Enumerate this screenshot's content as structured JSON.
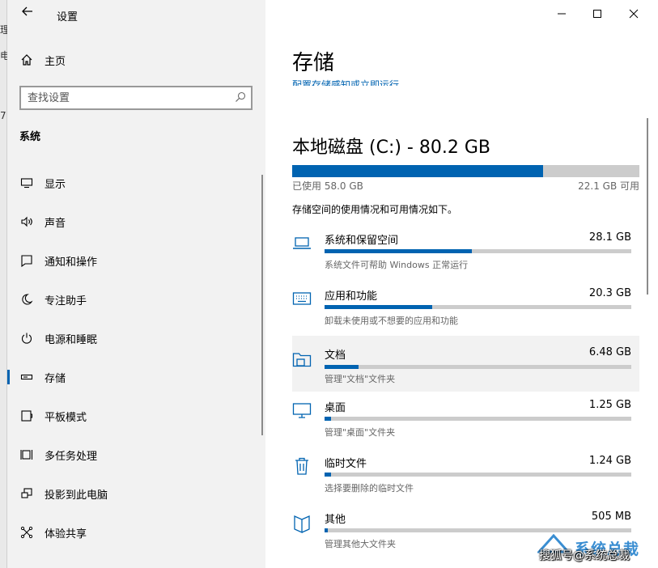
{
  "background_fragments": [
    "理",
    "电",
    "7"
  ],
  "window": {
    "title": "设置"
  },
  "sidebar": {
    "home_label": "主页",
    "search_placeholder": "查找设置",
    "section_title": "系统",
    "items": [
      {
        "label": "显示",
        "icon": "monitor-icon"
      },
      {
        "label": "声音",
        "icon": "speaker-icon"
      },
      {
        "label": "通知和操作",
        "icon": "notification-icon"
      },
      {
        "label": "专注助手",
        "icon": "moon-icon"
      },
      {
        "label": "电源和睡眠",
        "icon": "power-icon"
      },
      {
        "label": "存储",
        "icon": "storage-icon",
        "selected": true
      },
      {
        "label": "平板模式",
        "icon": "tablet-icon"
      },
      {
        "label": "多任务处理",
        "icon": "multitask-icon"
      },
      {
        "label": "投影到此电脑",
        "icon": "project-icon"
      },
      {
        "label": "体验共享",
        "icon": "share-icon"
      }
    ]
  },
  "main": {
    "title": "存储",
    "subtitle_link": "配置存储感知或立即运行",
    "drive": {
      "title": "本地磁盘 (C:) - 80.2 GB",
      "used": "已使用 58.0 GB",
      "free": "22.1 GB 可用",
      "used_fraction": 0.723
    },
    "description": "存储空间的使用情况和可用情况如下。",
    "categories": [
      {
        "name": "系统和保留空间",
        "size": "28.1 GB",
        "sub": "系统文件可帮助 Windows 正常运行",
        "fraction": 0.48,
        "icon": "laptop-icon"
      },
      {
        "name": "应用和功能",
        "size": "20.3 GB",
        "sub": "卸载未使用或不想要的应用和功能",
        "fraction": 0.35,
        "icon": "keyboard-icon"
      },
      {
        "name": "文档",
        "size": "6.48 GB",
        "sub": "管理\"文档\"文件夹",
        "fraction": 0.11,
        "icon": "folder-icon",
        "highlighted": true
      },
      {
        "name": "桌面",
        "size": "1.25 GB",
        "sub": "管理\"桌面\"文件夹",
        "fraction": 0.02,
        "icon": "desktop-icon"
      },
      {
        "name": "临时文件",
        "size": "1.24 GB",
        "sub": "选择要删除的临时文件",
        "fraction": 0.02,
        "icon": "trash-icon"
      },
      {
        "name": "其他",
        "size": "505 MB",
        "sub": "管理其他大文件夹",
        "fraction": 0.01,
        "icon": "book-icon"
      }
    ]
  },
  "watermark": {
    "brand": "系统总裁",
    "text": "搜狐号@系统总裁"
  },
  "colors": {
    "accent": "#0063b1",
    "bar_bg": "#cccccc",
    "sidebar_bg": "#f2f2f2"
  }
}
